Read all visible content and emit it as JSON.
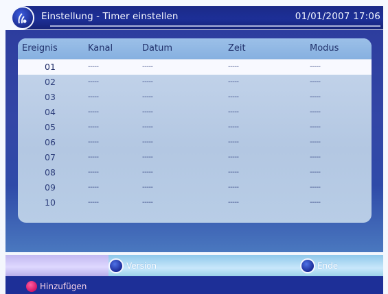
{
  "header": {
    "title": "Einstellung - Timer einstellen",
    "datetime": "01/01/2007 17:06"
  },
  "table": {
    "columns": [
      "Ereignis",
      "Kanal",
      "Datum",
      "Zeit",
      "Modus"
    ],
    "rows": [
      {
        "ereignis": "01",
        "kanal": "-----",
        "datum": "-----",
        "zeit": "-----",
        "modus": "-----"
      },
      {
        "ereignis": "02",
        "kanal": "-----",
        "datum": "-----",
        "zeit": "-----",
        "modus": "-----"
      },
      {
        "ereignis": "03",
        "kanal": "-----",
        "datum": "-----",
        "zeit": "-----",
        "modus": "-----"
      },
      {
        "ereignis": "04",
        "kanal": "-----",
        "datum": "-----",
        "zeit": "-----",
        "modus": "-----"
      },
      {
        "ereignis": "05",
        "kanal": "-----",
        "datum": "-----",
        "zeit": "-----",
        "modus": "-----"
      },
      {
        "ereignis": "06",
        "kanal": "-----",
        "datum": "-----",
        "zeit": "-----",
        "modus": "-----"
      },
      {
        "ereignis": "07",
        "kanal": "-----",
        "datum": "-----",
        "zeit": "-----",
        "modus": "-----"
      },
      {
        "ereignis": "08",
        "kanal": "-----",
        "datum": "-----",
        "zeit": "-----",
        "modus": "-----"
      },
      {
        "ereignis": "09",
        "kanal": "-----",
        "datum": "-----",
        "zeit": "-----",
        "modus": "-----"
      },
      {
        "ereignis": "10",
        "kanal": "-----",
        "datum": "-----",
        "zeit": "-----",
        "modus": "-----"
      }
    ],
    "selected_row": "01"
  },
  "footer": {
    "version_label": "Version",
    "close_label": "Ende",
    "add_label": "Hinzufügen"
  },
  "colors": {
    "header_blue": "#1d2f97",
    "panel_blue": "#3346a6",
    "selected_row": "#f8f9ff",
    "add_button_red": "#d51767"
  },
  "icons": {
    "logo": "antenna-logo-icon",
    "version_button": "blue-circle-button-icon",
    "close_button": "blue-circle-button-icon",
    "add_button": "red-circle-button-icon"
  }
}
